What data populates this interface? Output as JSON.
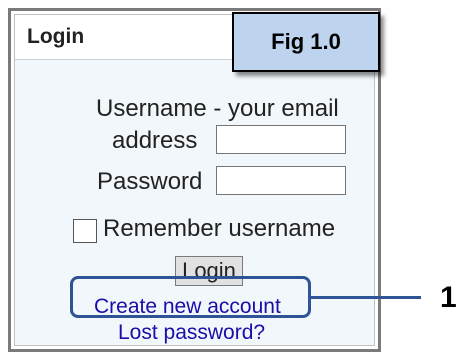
{
  "login_panel": {
    "title": "Login",
    "username_label_line1": "Username - your email",
    "username_label_line2": "address",
    "username_value": "",
    "password_label": "Password",
    "password_value": "",
    "remember_label": "Remember username",
    "login_button": "Login",
    "create_account_link": "Create new account",
    "lost_password_link": "Lost password?"
  },
  "annotations": {
    "figure_label": "Fig 1.0",
    "callout_number": "1",
    "badge_color": "#bdd3ee",
    "highlight_color": "#2f5496"
  }
}
